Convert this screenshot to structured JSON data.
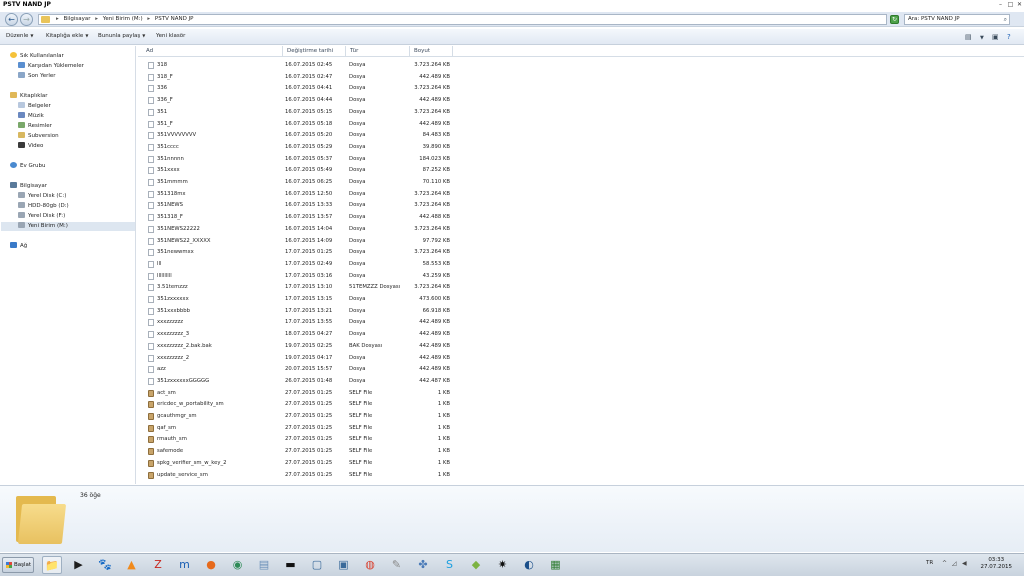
{
  "window": {
    "title": "PSTV NAND JP",
    "min": "–",
    "max": "□",
    "close": "✕"
  },
  "address": {
    "crumbs": [
      "Bilgisayar",
      "Yeni Birim (M:)",
      "PSTV NAND JP"
    ],
    "search_text": "Ara: PSTV NAND JP"
  },
  "toolbar": {
    "organize": "Düzenle",
    "add_library": "Kitaplığa ekle",
    "share": "Bununla paylaş",
    "new_folder": "Yeni klasör"
  },
  "nav": {
    "favorites": "Sık Kullanılanlar",
    "fav_items": [
      "Karşıdan Yüklemeler",
      "Son Yerler"
    ],
    "libraries": "Kitaplıklar",
    "lib_items": [
      "Belgeler",
      "Müzik",
      "Resimler",
      "Subversion",
      "Video"
    ],
    "homegroup": "Ev Grubu",
    "computer": "Bilgisayar",
    "comp_items": [
      "Yerel Disk (C:)",
      "HDD-80gb (D:)",
      "Yerel Disk (F:)",
      "Yeni Birim (M:)"
    ],
    "network": "Ağ"
  },
  "columns": {
    "name": "Ad",
    "date": "Değiştirme tarihi",
    "type": "Tür",
    "size": "Boyut"
  },
  "files": [
    {
      "name": "318",
      "date": "16.07.2015 02:45",
      "type": "Dosya",
      "size": "3.723.264 KB"
    },
    {
      "name": "318_F",
      "date": "16.07.2015 02:47",
      "type": "Dosya",
      "size": "442.489 KB"
    },
    {
      "name": "336",
      "date": "16.07.2015 04:41",
      "type": "Dosya",
      "size": "3.723.264 KB"
    },
    {
      "name": "336_F",
      "date": "16.07.2015 04:44",
      "type": "Dosya",
      "size": "442.489 KB"
    },
    {
      "name": "351",
      "date": "16.07.2015 05:15",
      "type": "Dosya",
      "size": "3.723.264 KB"
    },
    {
      "name": "351_F",
      "date": "16.07.2015 05:18",
      "type": "Dosya",
      "size": "442.489 KB"
    },
    {
      "name": "351VVVVVVVV",
      "date": "16.07.2015 05:20",
      "type": "Dosya",
      "size": "84.483 KB"
    },
    {
      "name": "351cccc",
      "date": "16.07.2015 05:29",
      "type": "Dosya",
      "size": "39.890 KB"
    },
    {
      "name": "351nnnnn",
      "date": "16.07.2015 05:37",
      "type": "Dosya",
      "size": "184.023 KB"
    },
    {
      "name": "351xxxx",
      "date": "16.07.2015 05:49",
      "type": "Dosya",
      "size": "87.252 KB"
    },
    {
      "name": "351mmmm",
      "date": "16.07.2015 06:25",
      "type": "Dosya",
      "size": "70.110 KB"
    },
    {
      "name": "351318mx",
      "date": "16.07.2015 12:50",
      "type": "Dosya",
      "size": "3.723.264 KB"
    },
    {
      "name": "351NEWS",
      "date": "16.07.2015 13:33",
      "type": "Dosya",
      "size": "3.723.264 KB"
    },
    {
      "name": "351318_F",
      "date": "16.07.2015 13:57",
      "type": "Dosya",
      "size": "442.488 KB"
    },
    {
      "name": "351NEWS22222",
      "date": "16.07.2015 14:04",
      "type": "Dosya",
      "size": "3.723.264 KB"
    },
    {
      "name": "351NEWS22_XXXXX",
      "date": "16.07.2015 14:09",
      "type": "Dosya",
      "size": "97.792 KB"
    },
    {
      "name": "351newwmxx",
      "date": "17.07.2015 01:25",
      "type": "Dosya",
      "size": "3.723.264 KB"
    },
    {
      "name": "lll",
      "date": "17.07.2015 02:49",
      "type": "Dosya",
      "size": "58.553 KB"
    },
    {
      "name": "llllllllll",
      "date": "17.07.2015 03:16",
      "type": "Dosya",
      "size": "43.259 KB"
    },
    {
      "name": "3.51temzzz",
      "date": "17.07.2015 13:10",
      "type": "51TEMZZZ Dosyası",
      "size": "3.723.264 KB"
    },
    {
      "name": "351zxxxxxx",
      "date": "17.07.2015 13:15",
      "type": "Dosya",
      "size": "473.600 KB"
    },
    {
      "name": "351xxxbbbb",
      "date": "17.07.2015 13:21",
      "type": "Dosya",
      "size": "66.918 KB"
    },
    {
      "name": "xxxzzzzzz",
      "date": "17.07.2015 13:55",
      "type": "Dosya",
      "size": "442.489 KB"
    },
    {
      "name": "xxxzzzzzz_3",
      "date": "18.07.2015 04:27",
      "type": "Dosya",
      "size": "442.489 KB"
    },
    {
      "name": "xxxzzzzzz_2.bak.bak",
      "date": "19.07.2015 02:25",
      "type": "BAK Dosyası",
      "size": "442.489 KB"
    },
    {
      "name": "xxxzzzzzz_2",
      "date": "19.07.2015 04:17",
      "type": "Dosya",
      "size": "442.489 KB"
    },
    {
      "name": "azz",
      "date": "20.07.2015 15:57",
      "type": "Dosya",
      "size": "442.489 KB"
    },
    {
      "name": "351zxxxxxxGGGGG",
      "date": "26.07.2015 01:48",
      "type": "Dosya",
      "size": "442.487 KB"
    },
    {
      "name": "act_sm",
      "date": "27.07.2015 01:25",
      "type": "SELF File",
      "size": "1 KB",
      "self": true
    },
    {
      "name": "ericdec_w_portability_sm",
      "date": "27.07.2015 01:25",
      "type": "SELF File",
      "size": "1 KB",
      "self": true
    },
    {
      "name": "gcauthmgr_sm",
      "date": "27.07.2015 01:25",
      "type": "SELF File",
      "size": "1 KB",
      "self": true
    },
    {
      "name": "qaf_sm",
      "date": "27.07.2015 01:25",
      "type": "SELF File",
      "size": "1 KB",
      "self": true
    },
    {
      "name": "rmauth_sm",
      "date": "27.07.2015 01:25",
      "type": "SELF File",
      "size": "1 KB",
      "self": true
    },
    {
      "name": "safemode",
      "date": "27.07.2015 01:25",
      "type": "SELF File",
      "size": "1 KB",
      "self": true
    },
    {
      "name": "spkg_verifier_sm_w_key_2",
      "date": "27.07.2015 01:25",
      "type": "SELF File",
      "size": "1 KB",
      "self": true
    },
    {
      "name": "update_service_sm",
      "date": "27.07.2015 01:25",
      "type": "SELF File",
      "size": "1 KB",
      "self": true
    }
  ],
  "details": {
    "count": "36 öğe"
  },
  "taskbar": {
    "start": "Başlat",
    "apps": [
      {
        "icon": "folder-icon",
        "glyph": "📁",
        "active": true
      },
      {
        "icon": "media-icon",
        "glyph": "▶"
      },
      {
        "icon": "gimp-icon",
        "glyph": "🐾"
      },
      {
        "icon": "vlc-icon",
        "glyph": "▲",
        "color": "#f08a1c"
      },
      {
        "icon": "filezilla-icon",
        "glyph": "Z",
        "color": "#c8261e"
      },
      {
        "icon": "m-app-icon",
        "glyph": "m",
        "color": "#1a5fb4"
      },
      {
        "icon": "firefox-icon",
        "glyph": "●",
        "color": "#e66a1c"
      },
      {
        "icon": "globe-icon",
        "glyph": "◉",
        "color": "#2e8b57"
      },
      {
        "icon": "document-icon",
        "glyph": "▤",
        "color": "#6a8fb8"
      },
      {
        "icon": "terminal-icon",
        "glyph": "▬",
        "color": "#111"
      },
      {
        "icon": "window-icon",
        "glyph": "▢",
        "color": "#3a6a9a"
      },
      {
        "icon": "window-icon",
        "glyph": "▣",
        "color": "#3a6a9a"
      },
      {
        "icon": "chrome-icon",
        "glyph": "◍",
        "color": "#d9412f"
      },
      {
        "icon": "tools-icon",
        "glyph": "✎",
        "color": "#888"
      },
      {
        "icon": "puzzle-icon",
        "glyph": "✤",
        "color": "#4a7ab8"
      },
      {
        "icon": "skype-icon",
        "glyph": "S",
        "color": "#1a9fe0"
      },
      {
        "icon": "android-icon",
        "glyph": "◆",
        "color": "#7cb342"
      },
      {
        "icon": "burst-icon",
        "glyph": "✷",
        "color": "#111"
      },
      {
        "icon": "steam-icon",
        "glyph": "◐",
        "color": "#1b4f8a"
      },
      {
        "icon": "chart-app-icon",
        "glyph": "▦",
        "color": "#2e7d32"
      }
    ],
    "lang": "TR",
    "time": "03:33",
    "date": "27.07.2015"
  }
}
